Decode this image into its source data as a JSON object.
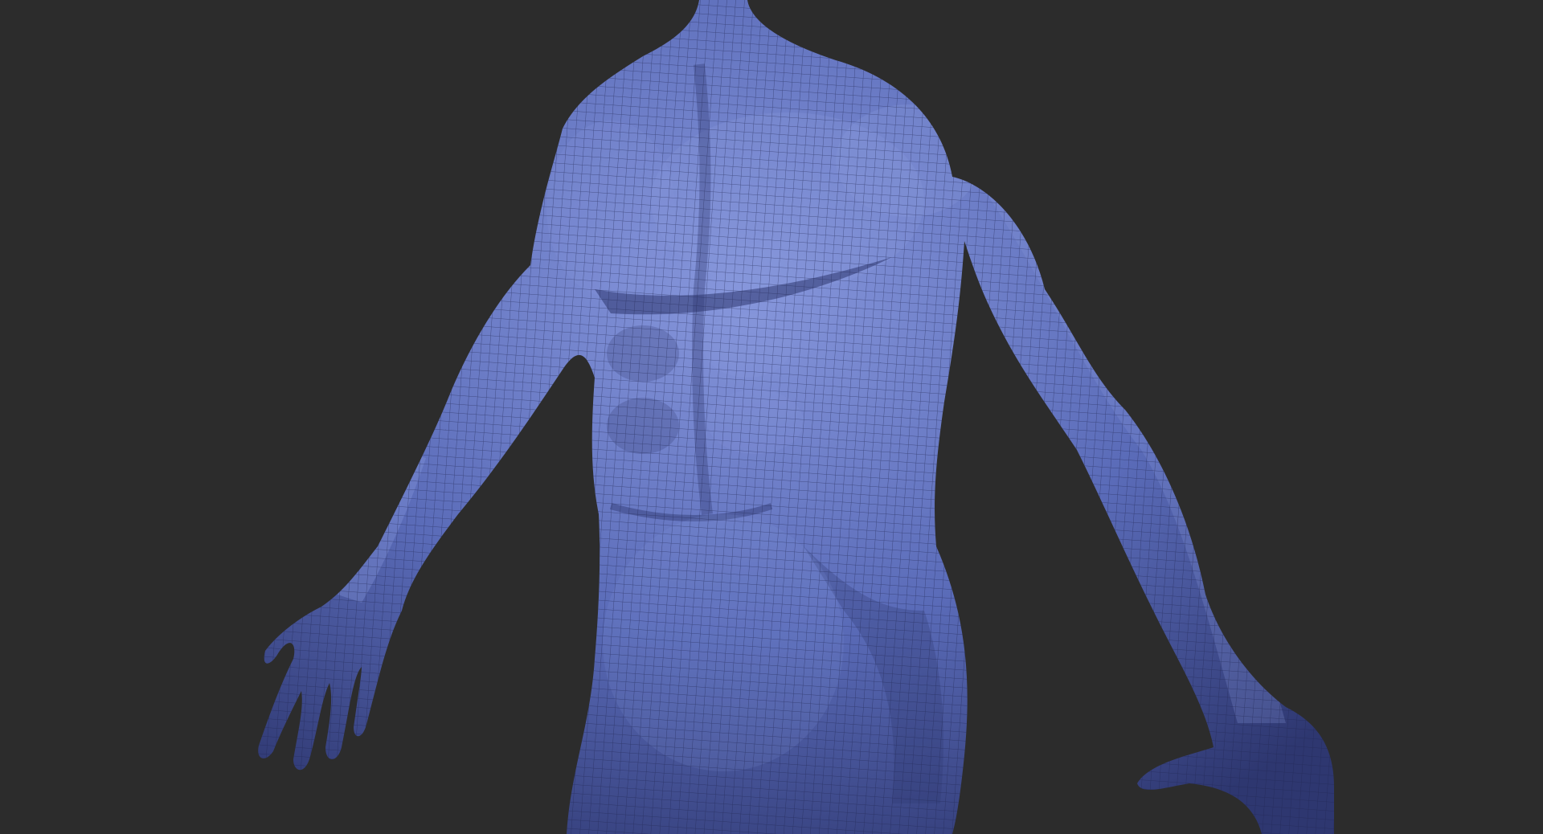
{
  "viewport": {
    "background_color": "#2c2c2c"
  },
  "model": {
    "subject": "male-torso-sculpt",
    "material_base_color": "#5a6bb8",
    "material_highlight_color": "#8797dc",
    "material_shadow_color": "#2e3770",
    "wireframe_color": "#1e2550",
    "wireframe_visible": true
  }
}
